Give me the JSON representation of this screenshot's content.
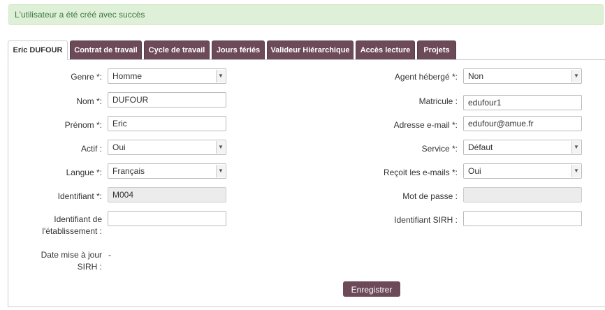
{
  "alert": {
    "message": "L'utilisateur a été créé avec succès"
  },
  "tabs": [
    {
      "label": "Eric DUFOUR"
    },
    {
      "label": "Contrat de travail"
    },
    {
      "label": "Cycle de travail"
    },
    {
      "label": "Jours fériés"
    },
    {
      "label": "Valideur Hiérarchique"
    },
    {
      "label": "Accès lecture"
    },
    {
      "label": "Projets"
    }
  ],
  "left": {
    "genre": {
      "label": "Genre *:",
      "value": "Homme"
    },
    "nom": {
      "label": "Nom *:",
      "value": "DUFOUR"
    },
    "prenom": {
      "label": "Prénom *:",
      "value": "Eric"
    },
    "actif": {
      "label": "Actif :",
      "value": "Oui"
    },
    "langue": {
      "label": "Langue *:",
      "value": "Français"
    },
    "identifiant": {
      "label": "Identifiant *:",
      "value": "M004"
    },
    "identifiant_etab": {
      "label_line1": "Identifiant de",
      "label_line2": "l'établissement :",
      "value": ""
    },
    "date_sirh": {
      "label_line1": "Date mise à jour",
      "label_line2": "SIRH :",
      "value": "-"
    }
  },
  "right": {
    "agent_heberge": {
      "label": "Agent hébergé *:",
      "value": "Non"
    },
    "matricule": {
      "label": "Matricule :",
      "value": "edufour1"
    },
    "email": {
      "label": "Adresse e-mail *:",
      "value": "edufour@amue.fr"
    },
    "service": {
      "label": "Service *:",
      "value": "Défaut"
    },
    "recoit_emails": {
      "label": "Reçoit les e-mails *:",
      "value": "Oui"
    },
    "mot_de_passe": {
      "label": "Mot de passe :",
      "value": ""
    },
    "identifiant_sirh": {
      "label": "Identifiant SIRH :",
      "value": ""
    }
  },
  "actions": {
    "save_label": "Enregistrer"
  },
  "icons": {
    "dropdown_arrow": "chevron-down-icon"
  },
  "colors": {
    "tab_bg": "#6d4a58",
    "alert_bg": "#dff0d8",
    "alert_text": "#3c763d"
  }
}
